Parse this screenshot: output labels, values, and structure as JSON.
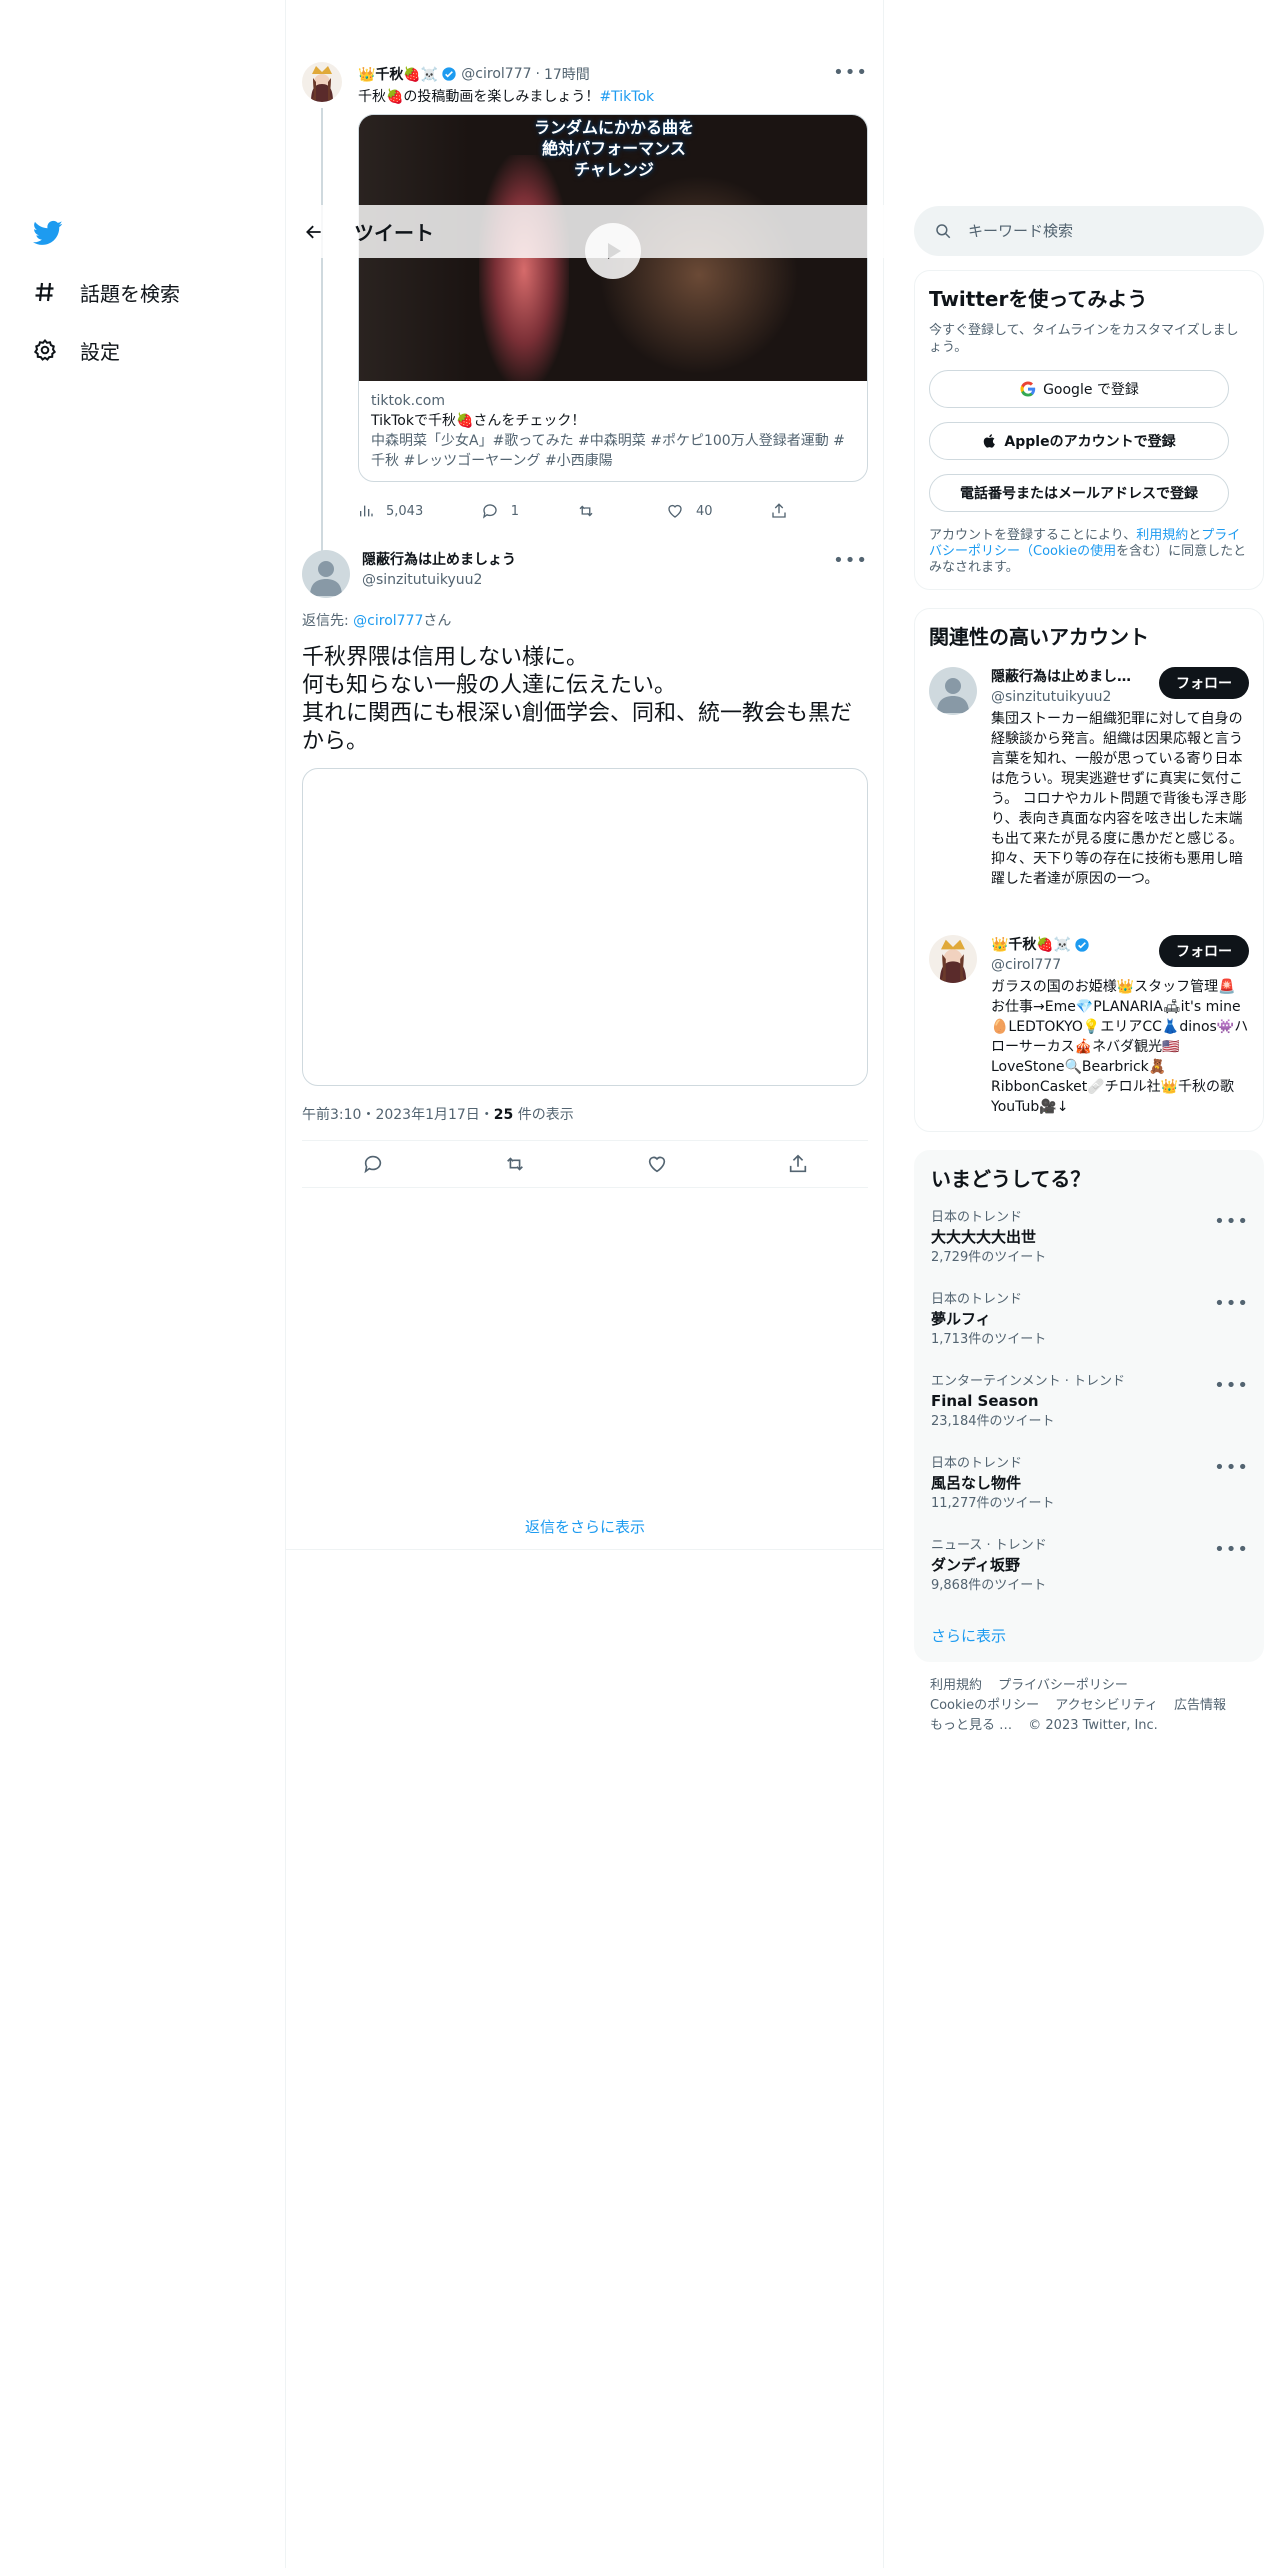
{
  "nav": {
    "items": [
      {
        "label": "話題を検索",
        "icon": "hashtag-icon"
      },
      {
        "label": "設定",
        "icon": "gear-icon"
      }
    ]
  },
  "header": {
    "title": "ツイート"
  },
  "parent_tweet": {
    "display_name": "👑千秋🍓☠️",
    "handle": "@cirol777",
    "time": "17時間",
    "text": "千秋🍓の投稿動画を楽しみましょう！",
    "hashtag": "#TikTok",
    "card": {
      "caption_lines": [
        "ランダムにかかる曲を",
        "絶対パフォーマンス",
        "チャレンジ"
      ],
      "domain": "tiktok.com",
      "title": "TikTokで千秋🍓さんをチェック！",
      "description": "中森明菜「少女A」#歌ってみた #中森明菜 #ポケピ100万人登録者運動 #千秋 #レッツゴーヤーング #小西康陽"
    },
    "stats": {
      "views": "5,043",
      "replies": "1",
      "retweets": "",
      "likes": "40"
    }
  },
  "main_tweet": {
    "display_name": "隠蔽行為は止めましょう",
    "handle": "@sinzitutuikyuu2",
    "reply_to_label": "返信先: ",
    "reply_to_handle": "@cirol777",
    "reply_to_suffix": "さん",
    "text_lines": [
      "千秋界隈は信用しない様に。",
      "何も知らない一般の人達に伝えたい。",
      "其れに関西にも根深い創価学会、同和、統一教会も黒だから。"
    ],
    "timestamp": "午前3:10・2023年1月17日・",
    "views_count": "25",
    "views_label": " 件の表示"
  },
  "show_more_replies": "返信をさらに表示",
  "search": {
    "placeholder": "キーワード検索"
  },
  "signup": {
    "title": "Twitterを使ってみよう",
    "subtitle": "今すぐ登録して、タイムラインをカスタマイズしましょう。",
    "google_label": "Google で登録",
    "apple_label": "Appleのアカウントで登録",
    "phone_label": "電話番号またはメールアドレスで登録",
    "legal_prefix": "アカウントを登録することにより、",
    "legal_link1": "利用規約",
    "legal_and": "と",
    "legal_link2": "プライバシーポリシー（Cookieの使用",
    "legal_suffix": "を含む）に同意したとみなされます。"
  },
  "related": {
    "title": "関連性の高いアカウント",
    "follow_label": "フォロー",
    "accounts": [
      {
        "name": "隠蔽行為は止めまし…",
        "handle": "@sinzitutuikyuu2",
        "bio": "集団ストーカー組織犯罪に対して自身の経験談から発言。組織は因果応報と言う言葉を知れ、一般が思っている寄り日本は危うい。現実逃避せずに真実に気付こう。 コロナやカルト問題で背後も浮き彫り、表向き真面な内容を呟き出した末端も出て来たが見る度に愚かだと感じる。抑々、天下り等の存在に技術も悪用し暗躍した者達が原因の一つ。"
      },
      {
        "name": "👑千秋🍓☠️",
        "handle": "@cirol777",
        "bio": "ガラスの国のお姫様👑スタッフ管理🚨お仕事→Eme💎PLANARIA🛋it's mine🥚LEDTOKYO💡エリアCC👗dinos👾ハローサーカス🎪ネバダ観光🇺🇸LoveStone🔍Bearbrick🧸RibbonCasket🩹チロル社👑千秋の歌YouTub🎥↓"
      }
    ]
  },
  "trends": {
    "title": "いまどうしてる？",
    "items": [
      {
        "category": "日本のトレンド",
        "title": "大大大大大出世",
        "count": "2,729件のツイート"
      },
      {
        "category": "日本のトレンド",
        "title": "夢ルフィ",
        "count": "1,713件のツイート"
      },
      {
        "category": "エンターテインメント · トレンド",
        "title": "Final Season",
        "count": "23,184件のツイート"
      },
      {
        "category": "日本のトレンド",
        "title": "風呂なし物件",
        "count": "11,277件のツイート"
      },
      {
        "category": "ニュース · トレンド",
        "title": "ダンディ坂野",
        "count": "9,868件のツイート"
      }
    ],
    "show_more": "さらに表示"
  },
  "footer": {
    "links": [
      "利用規約",
      "プライバシーポリシー",
      "Cookieのポリシー",
      "アクセシビリティ",
      "広告情報",
      "もっと見る …"
    ],
    "copyright": "© 2023 Twitter, Inc."
  },
  "colors": {
    "accent": "#1d9bf0",
    "text": "#0f1419",
    "secondary": "#536471",
    "border": "#cfd9de"
  }
}
